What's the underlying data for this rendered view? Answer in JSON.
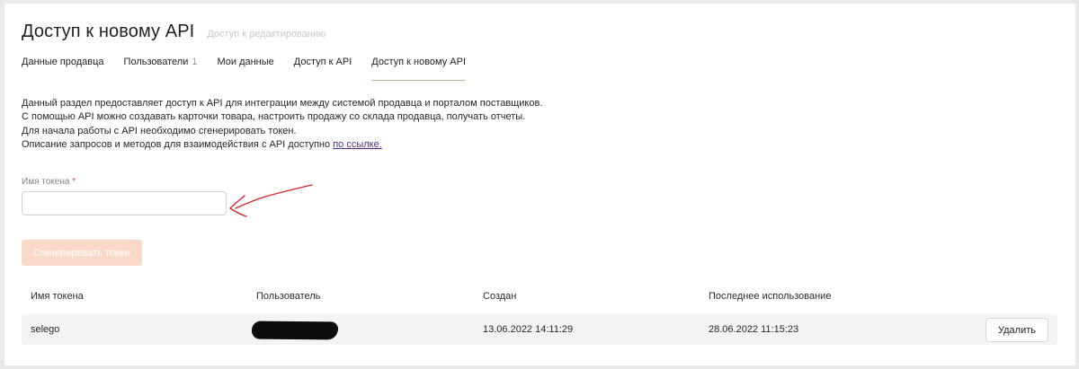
{
  "header": {
    "title": "Доступ к новому API",
    "subtitle": "Доступ к редактированию"
  },
  "tabs": [
    {
      "label": "Данные продавца",
      "count": null
    },
    {
      "label": "Пользователи",
      "count": "1"
    },
    {
      "label": "Мои данные",
      "count": null
    },
    {
      "label": "Доступ к API",
      "count": null
    },
    {
      "label": "Доступ к новому API",
      "count": null,
      "active": true
    }
  ],
  "description": {
    "line1": "Данный раздел предоставляет доступ к API для интеграции между системой продавца и порталом поставщиков.",
    "line2": "С помощью API можно создавать карточки товара, настроить продажу со склада продавца, получать отчеты.",
    "line3": "Для начала работы с API необходимо сгенерировать токен.",
    "line4_prefix": "Описание запросов и методов для взаимодействия с API доступно ",
    "line4_link": "по ссылке."
  },
  "form": {
    "token_name_label": "Имя токена",
    "required_mark": "*",
    "token_name_value": "",
    "generate_label": "Сгенерировать токен"
  },
  "table": {
    "headers": [
      "Имя токена",
      "Пользователь",
      "Создан",
      "Последнее использование"
    ],
    "rows": [
      {
        "name": "selego",
        "user": "",
        "created": "13.06.2022 14:11:29",
        "last_used": "28.06.2022 11:15:23",
        "delete_label": "Удалить"
      }
    ]
  },
  "colors": {
    "accent_underline": "#c7b895",
    "button_disabled": "#fbd9c8",
    "link": "#4b2f8c",
    "annotation": "#d7262b"
  }
}
